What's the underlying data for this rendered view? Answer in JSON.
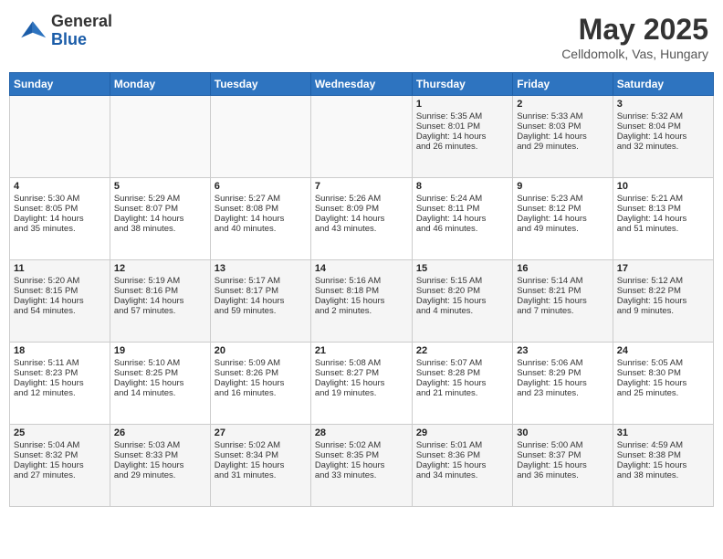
{
  "header": {
    "logo_general": "General",
    "logo_blue": "Blue",
    "month_title": "May 2025",
    "subtitle": "Celldomolk, Vas, Hungary"
  },
  "weekdays": [
    "Sunday",
    "Monday",
    "Tuesday",
    "Wednesday",
    "Thursday",
    "Friday",
    "Saturday"
  ],
  "weeks": [
    [
      {
        "day": "",
        "info": ""
      },
      {
        "day": "",
        "info": ""
      },
      {
        "day": "",
        "info": ""
      },
      {
        "day": "",
        "info": ""
      },
      {
        "day": "1",
        "info": "Sunrise: 5:35 AM\nSunset: 8:01 PM\nDaylight: 14 hours\nand 26 minutes."
      },
      {
        "day": "2",
        "info": "Sunrise: 5:33 AM\nSunset: 8:03 PM\nDaylight: 14 hours\nand 29 minutes."
      },
      {
        "day": "3",
        "info": "Sunrise: 5:32 AM\nSunset: 8:04 PM\nDaylight: 14 hours\nand 32 minutes."
      }
    ],
    [
      {
        "day": "4",
        "info": "Sunrise: 5:30 AM\nSunset: 8:05 PM\nDaylight: 14 hours\nand 35 minutes."
      },
      {
        "day": "5",
        "info": "Sunrise: 5:29 AM\nSunset: 8:07 PM\nDaylight: 14 hours\nand 38 minutes."
      },
      {
        "day": "6",
        "info": "Sunrise: 5:27 AM\nSunset: 8:08 PM\nDaylight: 14 hours\nand 40 minutes."
      },
      {
        "day": "7",
        "info": "Sunrise: 5:26 AM\nSunset: 8:09 PM\nDaylight: 14 hours\nand 43 minutes."
      },
      {
        "day": "8",
        "info": "Sunrise: 5:24 AM\nSunset: 8:11 PM\nDaylight: 14 hours\nand 46 minutes."
      },
      {
        "day": "9",
        "info": "Sunrise: 5:23 AM\nSunset: 8:12 PM\nDaylight: 14 hours\nand 49 minutes."
      },
      {
        "day": "10",
        "info": "Sunrise: 5:21 AM\nSunset: 8:13 PM\nDaylight: 14 hours\nand 51 minutes."
      }
    ],
    [
      {
        "day": "11",
        "info": "Sunrise: 5:20 AM\nSunset: 8:15 PM\nDaylight: 14 hours\nand 54 minutes."
      },
      {
        "day": "12",
        "info": "Sunrise: 5:19 AM\nSunset: 8:16 PM\nDaylight: 14 hours\nand 57 minutes."
      },
      {
        "day": "13",
        "info": "Sunrise: 5:17 AM\nSunset: 8:17 PM\nDaylight: 14 hours\nand 59 minutes."
      },
      {
        "day": "14",
        "info": "Sunrise: 5:16 AM\nSunset: 8:18 PM\nDaylight: 15 hours\nand 2 minutes."
      },
      {
        "day": "15",
        "info": "Sunrise: 5:15 AM\nSunset: 8:20 PM\nDaylight: 15 hours\nand 4 minutes."
      },
      {
        "day": "16",
        "info": "Sunrise: 5:14 AM\nSunset: 8:21 PM\nDaylight: 15 hours\nand 7 minutes."
      },
      {
        "day": "17",
        "info": "Sunrise: 5:12 AM\nSunset: 8:22 PM\nDaylight: 15 hours\nand 9 minutes."
      }
    ],
    [
      {
        "day": "18",
        "info": "Sunrise: 5:11 AM\nSunset: 8:23 PM\nDaylight: 15 hours\nand 12 minutes."
      },
      {
        "day": "19",
        "info": "Sunrise: 5:10 AM\nSunset: 8:25 PM\nDaylight: 15 hours\nand 14 minutes."
      },
      {
        "day": "20",
        "info": "Sunrise: 5:09 AM\nSunset: 8:26 PM\nDaylight: 15 hours\nand 16 minutes."
      },
      {
        "day": "21",
        "info": "Sunrise: 5:08 AM\nSunset: 8:27 PM\nDaylight: 15 hours\nand 19 minutes."
      },
      {
        "day": "22",
        "info": "Sunrise: 5:07 AM\nSunset: 8:28 PM\nDaylight: 15 hours\nand 21 minutes."
      },
      {
        "day": "23",
        "info": "Sunrise: 5:06 AM\nSunset: 8:29 PM\nDaylight: 15 hours\nand 23 minutes."
      },
      {
        "day": "24",
        "info": "Sunrise: 5:05 AM\nSunset: 8:30 PM\nDaylight: 15 hours\nand 25 minutes."
      }
    ],
    [
      {
        "day": "25",
        "info": "Sunrise: 5:04 AM\nSunset: 8:32 PM\nDaylight: 15 hours\nand 27 minutes."
      },
      {
        "day": "26",
        "info": "Sunrise: 5:03 AM\nSunset: 8:33 PM\nDaylight: 15 hours\nand 29 minutes."
      },
      {
        "day": "27",
        "info": "Sunrise: 5:02 AM\nSunset: 8:34 PM\nDaylight: 15 hours\nand 31 minutes."
      },
      {
        "day": "28",
        "info": "Sunrise: 5:02 AM\nSunset: 8:35 PM\nDaylight: 15 hours\nand 33 minutes."
      },
      {
        "day": "29",
        "info": "Sunrise: 5:01 AM\nSunset: 8:36 PM\nDaylight: 15 hours\nand 34 minutes."
      },
      {
        "day": "30",
        "info": "Sunrise: 5:00 AM\nSunset: 8:37 PM\nDaylight: 15 hours\nand 36 minutes."
      },
      {
        "day": "31",
        "info": "Sunrise: 4:59 AM\nSunset: 8:38 PM\nDaylight: 15 hours\nand 38 minutes."
      }
    ]
  ]
}
